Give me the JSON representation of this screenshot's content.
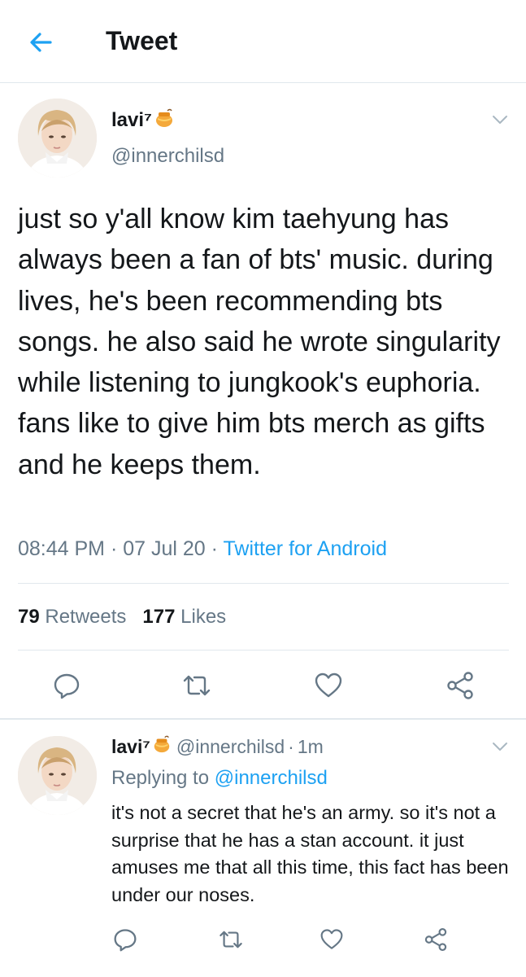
{
  "header": {
    "title": "Tweet",
    "back_icon": "arrow-left-icon",
    "accent": "#1da1f2"
  },
  "main_tweet": {
    "display_name": "lavi⁷",
    "name_emoji_icon": "honey-pot-icon",
    "handle": "@innerchilsd",
    "text": "just so y'all know kim taehyung has always been a fan of bts' music. during lives, he's been recommending bts songs. he also said he wrote singularity while listening to jungkook's euphoria. fans like to give him bts merch as gifts and he keeps them.",
    "time": "08:44 PM",
    "date": "07 Jul 20",
    "separator": "·",
    "source": "Twitter for Android",
    "retweets_count": "79",
    "retweets_label": "Retweets",
    "likes_count": "177",
    "likes_label": "Likes",
    "actions": [
      "reply-icon",
      "retweet-icon",
      "like-icon",
      "share-icon"
    ]
  },
  "reply_tweet": {
    "display_name": "lavi⁷",
    "name_emoji_icon": "honey-pot-icon",
    "handle": "@innerchilsd",
    "separator": "·",
    "time_ago": "1m",
    "replying_label": "Replying to",
    "replying_handle": "@innerchilsd",
    "text": "it's not a secret that he's an army. so it's not a surprise that he has a stan account. it just amuses me that all this time, this fact has been under our noses.",
    "actions": [
      "reply-icon",
      "retweet-icon",
      "like-icon",
      "share-icon"
    ]
  },
  "colors": {
    "text_primary": "#14171a",
    "text_secondary": "#657786",
    "link": "#1da1f2",
    "divider": "#e1e8ed"
  }
}
